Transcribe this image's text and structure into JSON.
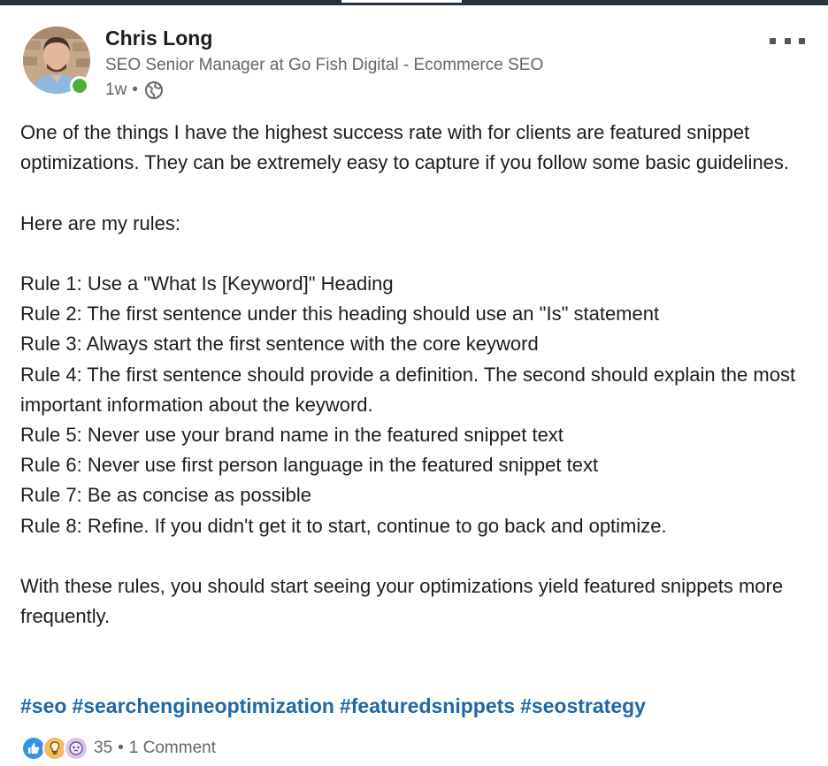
{
  "author": {
    "name": "Chris Long",
    "headline": "SEO Senior Manager at Go Fish Digital - Ecommerce SEO",
    "time": "1w",
    "separator": "•",
    "visibility_icon": "globe-icon",
    "online_status": "online"
  },
  "post": {
    "intro": "One of the things I have the highest success rate with for clients are featured snippet optimizations. They can be extremely easy to capture if you follow some basic guidelines.",
    "rules_intro": "Here are my rules:",
    "rules": [
      "Rule 1: Use a \"What Is [Keyword]\" Heading",
      "Rule 2: The first sentence under this heading should use an \"Is\" statement",
      "Rule 3: Always start the first sentence with the core keyword",
      "Rule 4: The first sentence should provide a definition. The second should explain the most important information about the keyword.",
      "Rule 5: Never use your brand name in the featured snippet text",
      "Rule 6: Never use first person language in the featured snippet text",
      "Rule 7: Be as concise as possible",
      "Rule 8: Refine. If you didn't get it to start, continue to go back and optimize."
    ],
    "closing": "With these rules, you should start seeing your optimizations yield featured snippets more frequently.",
    "hashtags": [
      "#seo",
      "#searchengineoptimization",
      "#featuredsnippets",
      "#seostrategy"
    ]
  },
  "social": {
    "reaction_icons": [
      "like-icon",
      "insightful-icon",
      "curious-icon"
    ],
    "reaction_count": "35",
    "separator": "•",
    "comments": "1 Comment"
  },
  "colors": {
    "hashtag": "#1f67a8",
    "online": "#4caf3c",
    "like": "#378fe9",
    "insightful": "#f5bb5c",
    "curious": "#dbc2ee"
  }
}
